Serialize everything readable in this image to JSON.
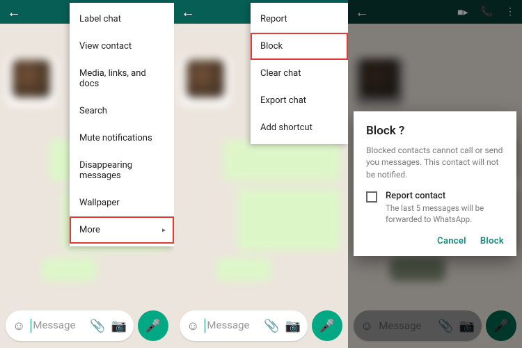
{
  "menu1": {
    "items": [
      {
        "label": "Label chat",
        "highlighted": false
      },
      {
        "label": "View contact",
        "highlighted": false
      },
      {
        "label": "Media, links, and docs",
        "highlighted": false
      },
      {
        "label": "Search",
        "highlighted": false
      },
      {
        "label": "Mute notifications",
        "highlighted": false
      },
      {
        "label": "Disappearing messages",
        "highlighted": false
      },
      {
        "label": "Wallpaper",
        "highlighted": false
      },
      {
        "label": "More",
        "highlighted": true,
        "has_arrow": true
      }
    ]
  },
  "menu2": {
    "items": [
      {
        "label": "Report",
        "highlighted": false
      },
      {
        "label": "Block",
        "highlighted": true
      },
      {
        "label": "Clear chat",
        "highlighted": false
      },
      {
        "label": "Export chat",
        "highlighted": false
      },
      {
        "label": "Add shortcut",
        "highlighted": false
      }
    ]
  },
  "dialog": {
    "title": "Block          ?",
    "body": "Blocked contacts cannot call or send you messages. This contact will not be notified.",
    "checkbox_label": "Report contact",
    "checkbox_sub": "The last 5 messages will be forwarded to WhatsApp.",
    "cancel": "Cancel",
    "confirm": "Block"
  },
  "input": {
    "placeholder": "Message"
  },
  "colors": {
    "whatsapp_header": "#075e54",
    "whatsapp_accent": "#128c7e",
    "mic_button": "#00a884",
    "highlight_box": "#e53935"
  }
}
